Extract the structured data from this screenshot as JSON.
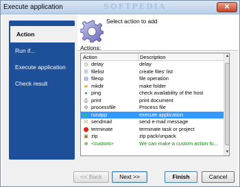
{
  "window": {
    "title": "Execute application",
    "watermark": "SOFTPEDIA",
    "close_icon": "close-x-icon"
  },
  "sidebar": {
    "items": [
      {
        "label": "Action",
        "active": true
      },
      {
        "label": "Run if...",
        "active": false
      },
      {
        "label": "Execute application",
        "active": false
      },
      {
        "label": "Check result",
        "active": false
      }
    ]
  },
  "header": {
    "text": "Select action to add",
    "icon": "gear-icon"
  },
  "actions_label": "Actions:",
  "table": {
    "columns": [
      "Action",
      "Description"
    ],
    "rows": [
      {
        "icon": "clock-icon",
        "name": "delay",
        "desc": "delay"
      },
      {
        "icon": "file-list-icon",
        "name": "filelist",
        "desc": "create files' list"
      },
      {
        "icon": "file-op-icon",
        "name": "fileop",
        "desc": "file operation"
      },
      {
        "icon": "folder-icon",
        "name": "mkdir",
        "desc": "make folder"
      },
      {
        "icon": "ping-icon",
        "name": "ping",
        "desc": "check availability of the host"
      },
      {
        "icon": "printer-icon",
        "name": "print",
        "desc": "print document"
      },
      {
        "icon": "process-icon",
        "name": "processfile",
        "desc": "Process file"
      },
      {
        "icon": "play-icon",
        "name": "runapp",
        "desc": "execute application",
        "selected": true
      },
      {
        "icon": "mail-icon",
        "name": "sendmail",
        "desc": "send e-mail message"
      },
      {
        "icon": "terminate-icon",
        "name": "terminate",
        "desc": "terminate task or project"
      },
      {
        "icon": "zip-icon",
        "name": "zip",
        "desc": "zip pack/unpack"
      },
      {
        "icon": "custom-icon",
        "name": "<custom>",
        "desc": "We can make a custom action fo..."
      }
    ]
  },
  "buttons": {
    "back": "<< Back",
    "next": "Next >>",
    "finish": "Finish",
    "cancel": "Cancel"
  }
}
